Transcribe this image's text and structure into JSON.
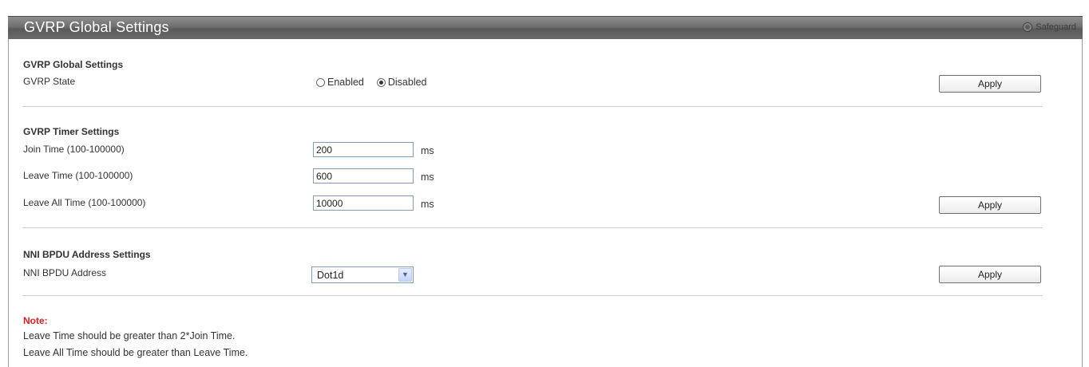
{
  "header": {
    "title": "GVRP Global Settings",
    "safeguard_label": "Safeguard",
    "safeguard_icon": "safeguard-status-icon"
  },
  "global": {
    "section_title": "GVRP Global Settings",
    "state_label": "GVRP State",
    "enabled_label": "Enabled",
    "disabled_label": "Disabled",
    "selected": "Disabled",
    "apply_label": "Apply"
  },
  "timers": {
    "section_title": "GVRP Timer Settings",
    "rows": [
      {
        "label": "Join Time (100-100000)",
        "value": "200",
        "unit": "ms"
      },
      {
        "label": "Leave Time (100-100000)",
        "value": "600",
        "unit": "ms"
      },
      {
        "label": "Leave All Time (100-100000)",
        "value": "10000",
        "unit": "ms"
      }
    ],
    "apply_label": "Apply"
  },
  "nni": {
    "section_title": "NNI BPDU Address Settings",
    "address_label": "NNI BPDU Address",
    "address_value": "Dot1d",
    "apply_label": "Apply"
  },
  "note": {
    "title": "Note:",
    "lines": [
      "Leave Time should be greater than 2*Join Time.",
      "Leave All Time should be greater than Leave Time."
    ]
  },
  "colors": {
    "title_bar": "#6f6f6f",
    "note_title": "#e02020",
    "input_border": "#7f9db9"
  }
}
